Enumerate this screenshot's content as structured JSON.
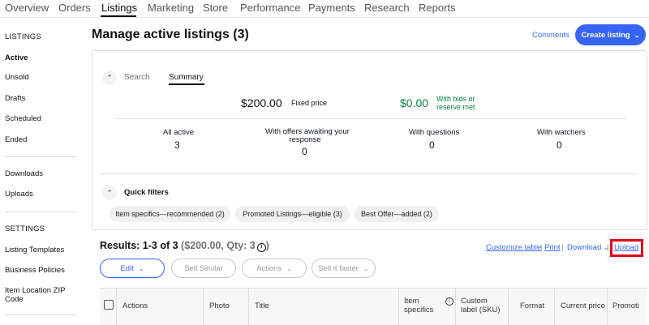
{
  "nav": {
    "tabs": [
      "Overview",
      "Orders",
      "Listings",
      "Marketing",
      "Store",
      "Performance",
      "Payments",
      "Research",
      "Reports"
    ],
    "active": "Listings"
  },
  "sidebar": {
    "listings_header": "LISTINGS",
    "items": [
      "Active",
      "Unsold",
      "Drafts",
      "Scheduled",
      "Ended"
    ],
    "extra": [
      "Downloads",
      "Uploads"
    ],
    "settings_header": "SETTINGS",
    "settings": [
      "Listing Templates",
      "Business Policies",
      "Item Location ZIP",
      "Code"
    ]
  },
  "header": {
    "title": "Manage active listings (3)",
    "comments": "Comments",
    "create": "Create listing"
  },
  "summary": {
    "search_tab": "Search",
    "summary_tab": "Summary",
    "fixed_amount": "$200.00",
    "fixed_label": "Fixed price",
    "bids_amount": "$0.00",
    "bids_label_1": "With bids or",
    "bids_label_2": "reserve met",
    "stats": [
      {
        "label": "All active",
        "label2": "",
        "value": "3"
      },
      {
        "label": "With offers awaiting your",
        "label2": "response",
        "value": "0"
      },
      {
        "label": "With questions",
        "label2": "",
        "value": "0"
      },
      {
        "label": "With watchers",
        "label2": "",
        "value": "0"
      }
    ]
  },
  "filters": {
    "title": "Quick filters",
    "chips": [
      "Item specifics—recommended (2)",
      "Promoted Listings—eligible (3)",
      "Best Offer—added (2)"
    ]
  },
  "results": {
    "title_main": "Results: 1-3 of 3 ",
    "title_muted": "($200.00, Qty: 3",
    "title_end": ")",
    "links": {
      "customize": "Customize table",
      "print": "Print",
      "download": "Download",
      "upload": "Upload",
      "sep": "|"
    },
    "buttons": {
      "edit": "Edit",
      "sell_similar": "Sell Similar",
      "actions": "Actions",
      "sell_faster": "Sell it faster"
    }
  },
  "table": {
    "columns": {
      "actions": "Actions",
      "photo": "Photo",
      "title": "Title",
      "item_specifics_1": "Item",
      "item_specifics_2": "specifics",
      "sku_1": "Custom",
      "sku_2": "label (SKU)",
      "format": "Format",
      "price": "Current price",
      "promoted": "Promoti"
    }
  },
  "colors": {
    "accent": "#3665f3",
    "green": "#05823f",
    "highlight": "#e0001b"
  }
}
